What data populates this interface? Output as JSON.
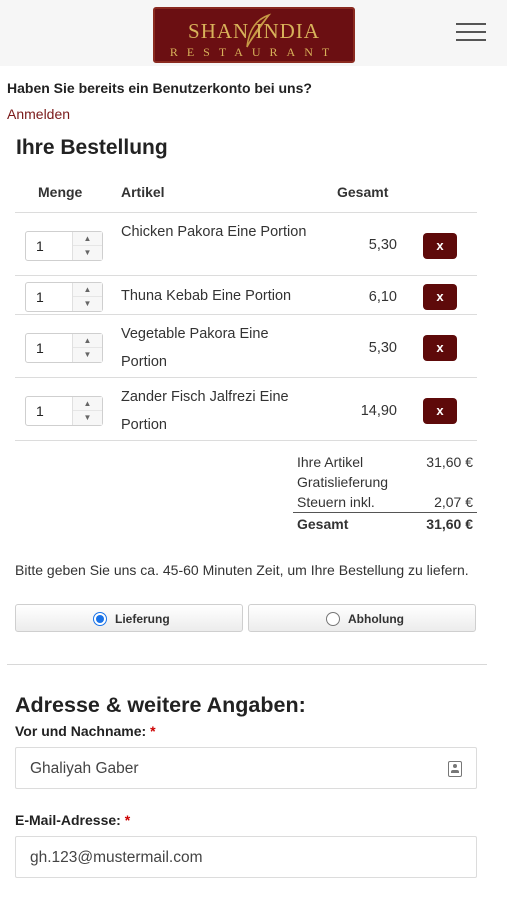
{
  "header": {
    "logo_line1": "SHAN INDIA",
    "logo_line2": "RESTAURANT",
    "logo_color": "#6b0f12",
    "logo_text_color": "#d8b25a",
    "menu_icon": "hamburger-menu-icon"
  },
  "account": {
    "question": "Haben Sie bereits ein Benutzerkonto bei uns?",
    "login_link": "Anmelden"
  },
  "order": {
    "title": "Ihre Bestellung",
    "columns": {
      "qty": "Menge",
      "item": "Artikel",
      "total": "Gesamt"
    },
    "items": [
      {
        "qty": "1",
        "name": "Chicken Pakora Eine Portion",
        "price": "5,30",
        "remove": "x"
      },
      {
        "qty": "1",
        "name": "Thuna Kebab Eine Portion",
        "price": "6,10",
        "remove": "x"
      },
      {
        "qty": "1",
        "name": "Vegetable Pakora Eine Portion",
        "price": "5,30",
        "remove": "x"
      },
      {
        "qty": "1",
        "name": "Zander Fisch Jalfrezi Eine Portion",
        "price": "14,90",
        "remove": "x"
      }
    ],
    "totals": {
      "items_label": "Ihre Artikel",
      "items_value": "31,60 €",
      "delivery_label": "Gratislieferung",
      "tax_label": "Steuern inkl.",
      "tax_value": "2,07 €",
      "total_label": "Gesamt",
      "total_value": "31,60 €"
    },
    "remove_color": "#5e0a0a"
  },
  "delivery": {
    "info": "Bitte geben Sie uns ca. 45-60 Minuten Zeit, um Ihre Bestellung zu liefern.",
    "option_delivery": "Lieferung",
    "option_pickup": "Abholung",
    "selected": "Lieferung"
  },
  "address": {
    "title": "Adresse & weitere Angaben:",
    "name_label": "Vor und Nachname:",
    "name_value": "Ghaliyah Gaber",
    "email_label": "E-Mail-Adresse:",
    "email_value": "gh.123@mustermail.com",
    "required_mark": "*"
  }
}
